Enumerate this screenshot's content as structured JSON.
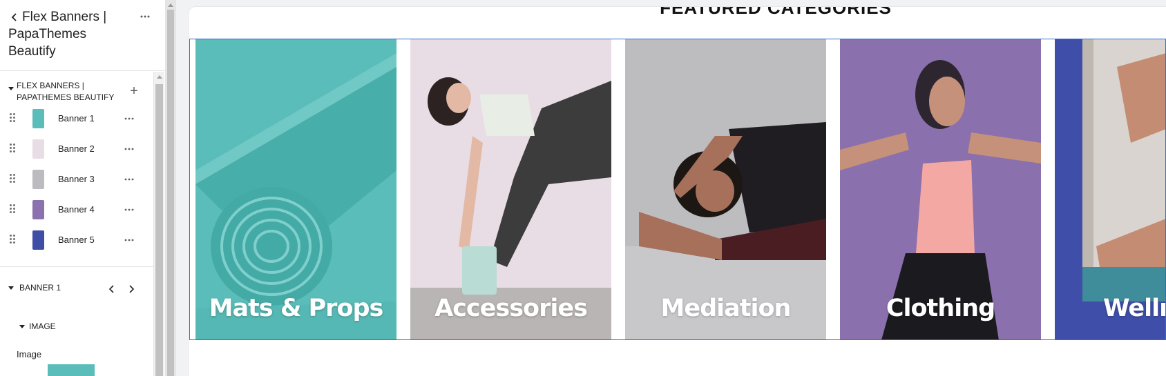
{
  "editor": {
    "header": {
      "title": "Flex Banners | PapaThemes Beautify"
    },
    "section": {
      "title": "FLEX BANNERS | PAPATHEMES BEAUTIFY"
    },
    "blocks": [
      {
        "label": "Banner 1",
        "color": "#5bbdba"
      },
      {
        "label": "Banner 2",
        "color": "#e7dde4"
      },
      {
        "label": "Banner 3",
        "color": "#bcbcc0"
      },
      {
        "label": "Banner 4",
        "color": "#8b72ae"
      },
      {
        "label": "Banner 5",
        "color": "#3f4ea5"
      }
    ],
    "selected_block": {
      "title": "BANNER 1"
    },
    "subsection": {
      "title": "IMAGE"
    },
    "image_field": {
      "label": "Image"
    }
  },
  "preview": {
    "heading": "FEATURED CATEGORIES",
    "banners": [
      {
        "label": "Mats & Props",
        "background": "#5bbdba"
      },
      {
        "label": "Accessories",
        "background": "#e8dde4"
      },
      {
        "label": "Mediation",
        "background": "#bdbdc0"
      },
      {
        "label": "Clothing",
        "background": "#8a70ad"
      },
      {
        "label": "Wellness",
        "background": "#3f4ea8"
      }
    ]
  },
  "icons": {
    "back": "chevron-left-icon",
    "more": "more-horizontal-icon",
    "add": "plus-icon",
    "drag": "drag-handle-icon",
    "prev": "chevron-left-icon",
    "next": "chevron-right-icon",
    "collapse": "caret-down-icon"
  },
  "colors": {
    "selection": "#2c6ecb",
    "panel_bg": "#ffffff",
    "canvas_bg": "#f1f2f4"
  }
}
